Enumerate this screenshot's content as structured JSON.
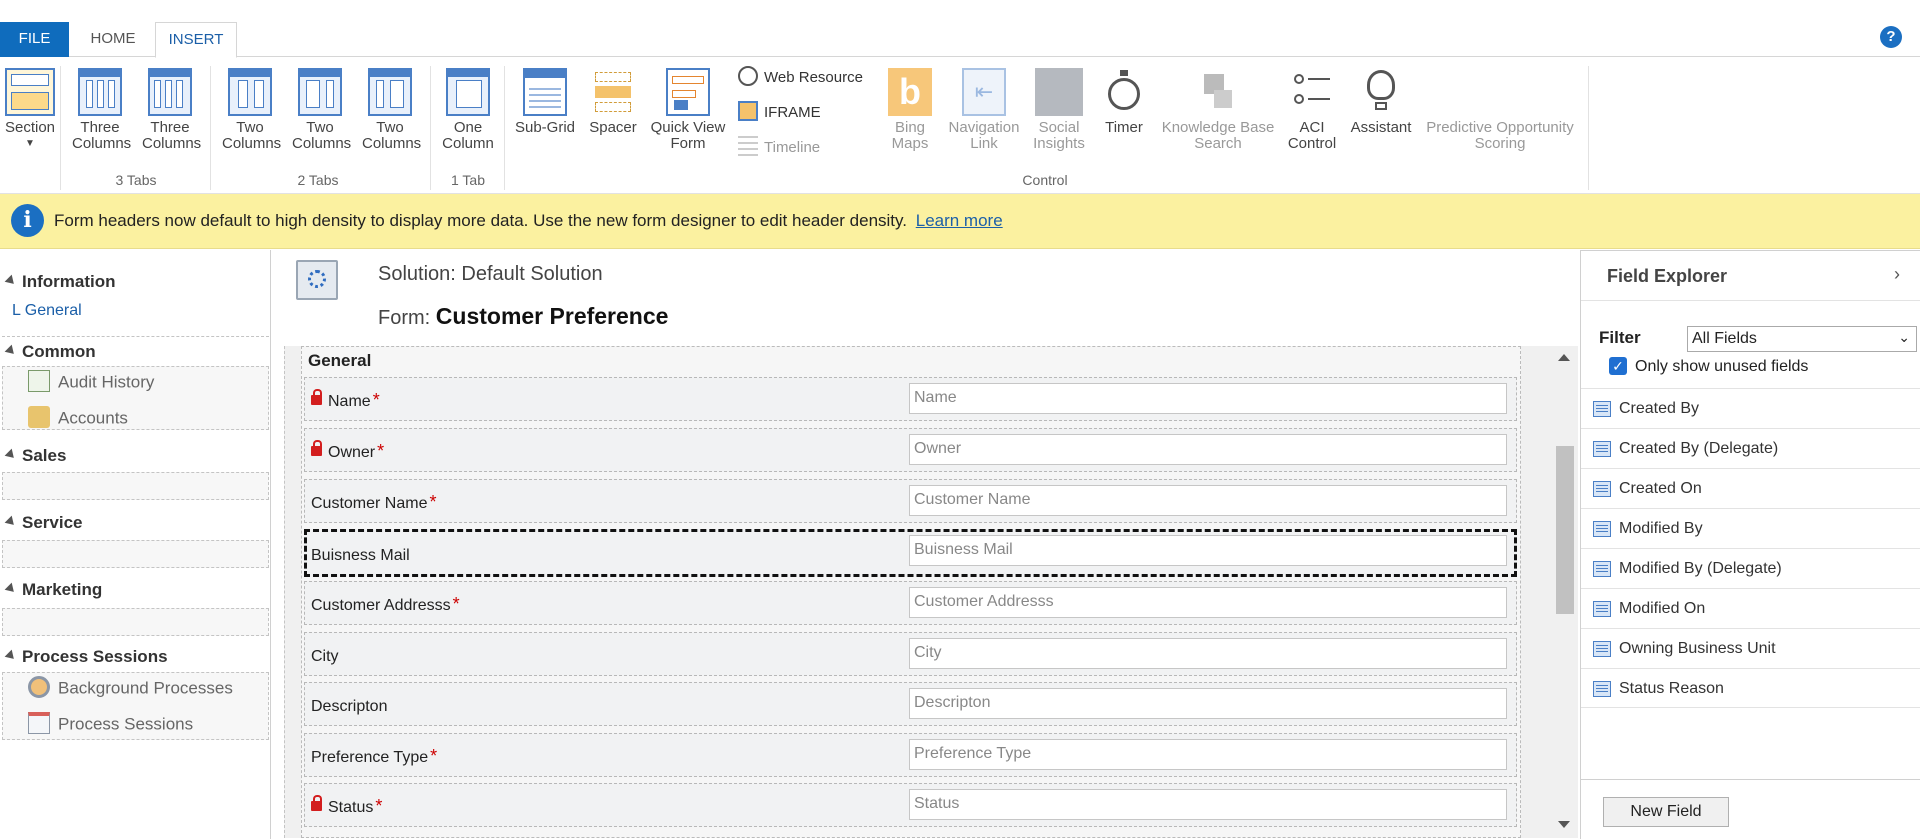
{
  "tabs": {
    "file": "FILE",
    "home": "HOME",
    "insert": "INSERT"
  },
  "help_icon": "?",
  "ribbon": {
    "section": {
      "label": "Section"
    },
    "tabs3": {
      "btn1_l1": "Three",
      "btn1_l2": "Columns",
      "btn2_l1": "Three",
      "btn2_l2": "Columns",
      "group": "3 Tabs"
    },
    "tabs2": {
      "btn1_l1": "Two",
      "btn1_l2": "Columns",
      "btn2_l1": "Two",
      "btn2_l2": "Columns",
      "btn3_l1": "Two",
      "btn3_l2": "Columns",
      "group": "2 Tabs"
    },
    "tabs1": {
      "btn1_l1": "One",
      "btn1_l2": "Column",
      "group": "1 Tab"
    },
    "control": {
      "subgrid": "Sub-Grid",
      "spacer": "Spacer",
      "quickview_l1": "Quick View",
      "quickview_l2": "Form",
      "web_resource": "Web Resource",
      "iframe": "IFRAME",
      "timeline": "Timeline",
      "bing_l1": "Bing",
      "bing_l2": "Maps",
      "nav_l1": "Navigation",
      "nav_l2": "Link",
      "social_l1": "Social",
      "social_l2": "Insights",
      "timer": "Timer",
      "kb_l1": "Knowledge Base",
      "kb_l2": "Search",
      "aci_l1": "ACI",
      "aci_l2": "Control",
      "assistant": "Assistant",
      "predictive_l1": "Predictive Opportunity",
      "predictive_l2": "Scoring",
      "group": "Control"
    }
  },
  "notification": {
    "text": "Form headers now default to high density to display more data. Use the new form designer to edit header density.",
    "link": "Learn more"
  },
  "leftnav": {
    "information": "Information",
    "general": "General",
    "common": "Common",
    "audit_history": "Audit History",
    "accounts": "Accounts",
    "sales": "Sales",
    "service": "Service",
    "marketing": "Marketing",
    "process_sessions_head": "Process Sessions",
    "background_processes": "Background Processes",
    "process_sessions": "Process Sessions"
  },
  "form": {
    "solution": "Solution: Default Solution",
    "form_prefix": "Form:",
    "form_name": "Customer Preference",
    "section_title": "General",
    "fields": [
      {
        "label": "Name",
        "placeholder": "Name",
        "required": "*"
      },
      {
        "label": "Owner",
        "placeholder": "Owner",
        "required": "*"
      },
      {
        "label": "Customer Name",
        "placeholder": "Customer Name",
        "required": "*"
      },
      {
        "label": "Buisness Mail",
        "placeholder": "Buisness Mail",
        "required": ""
      },
      {
        "label": "Customer Addresss",
        "placeholder": "Customer Addresss",
        "required": "*"
      },
      {
        "label": "City",
        "placeholder": "City",
        "required": ""
      },
      {
        "label": "Descripton",
        "placeholder": "Descripton",
        "required": ""
      },
      {
        "label": "Preference Type",
        "placeholder": "Preference Type",
        "required": "*"
      },
      {
        "label": "Status",
        "placeholder": "Status",
        "required": "*"
      }
    ]
  },
  "field_explorer": {
    "title": "Field Explorer",
    "chevron": "›",
    "filter_label": "Filter",
    "filter_value": "All Fields",
    "only_unused": "Only show unused fields",
    "items": [
      "Created By",
      "Created By (Delegate)",
      "Created On",
      "Modified By",
      "Modified By (Delegate)",
      "Modified On",
      "Owning Business Unit",
      "Status Reason"
    ],
    "new_field": "New Field"
  },
  "colors": {
    "accent": "#0f6cbd",
    "notification_bg": "#fbf1a0",
    "required": "#cc0000",
    "lock": "#d31e1e"
  }
}
